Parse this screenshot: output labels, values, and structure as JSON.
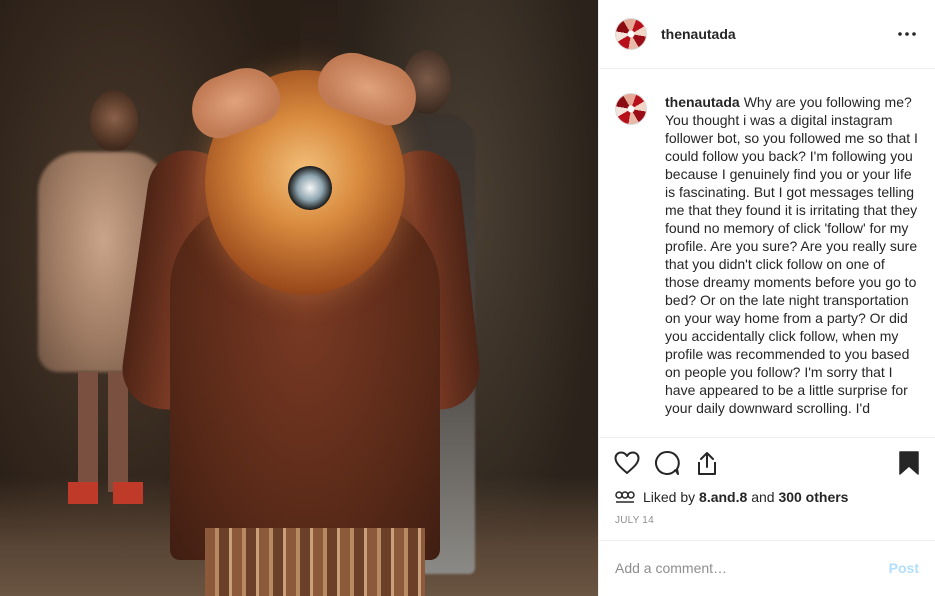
{
  "post": {
    "username": "thenautada",
    "caption": "Why are you following me? You thought i was a digital instagram follower bot, so you followed me so that I could follow you back? I'm following you because I genuinely find you or your life is fascinating. But I got messages telling me that they found it is irritating that they found no memory of click 'follow' for my profile. Are you sure? Are you really sure that you didn't click follow on one of those dreamy moments before you go to bed? Or on the late night transportation on your way home from a party? Or did you accidentally click follow, when my profile was recommended to you based on people you follow? I'm sorry that I have appeared to be a little surprise for your daily downward scrolling. I'd",
    "likes": {
      "prefix": "Liked by",
      "first_liker": "8.and.8",
      "joiner": "and",
      "others": "300 others"
    },
    "date": "JULY 14"
  },
  "comment": {
    "placeholder": "Add a comment…",
    "post_label": "Post"
  },
  "icons": {
    "more": "more-options-icon",
    "like": "heart-icon",
    "comment": "comment-icon",
    "share": "share-icon",
    "save": "bookmark-icon",
    "likers": "likers-avatars-icon"
  },
  "colors": {
    "text": "#262626",
    "muted": "#8e8e8e",
    "border": "#efefef",
    "post_disabled": "#b2dffc"
  }
}
